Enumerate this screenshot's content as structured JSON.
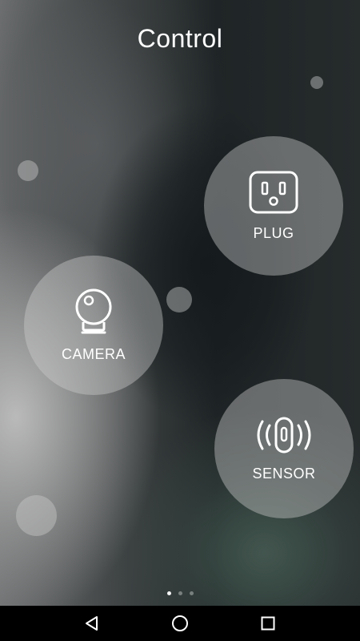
{
  "header": {
    "title": "Control"
  },
  "devices": [
    {
      "label": "PLUG",
      "icon": "power-outlet-icon"
    },
    {
      "label": "CAMERA",
      "icon": "webcam-icon"
    },
    {
      "label": "SENSOR",
      "icon": "motion-sensor-icon"
    }
  ],
  "pager": {
    "pages": 3,
    "active_page": 1
  },
  "navbar": {
    "icons": [
      "back-icon",
      "home-icon",
      "recents-icon"
    ]
  },
  "colors": {
    "text": "#ffffff",
    "tile": "#cdcdcd",
    "navbar": "#000000"
  }
}
